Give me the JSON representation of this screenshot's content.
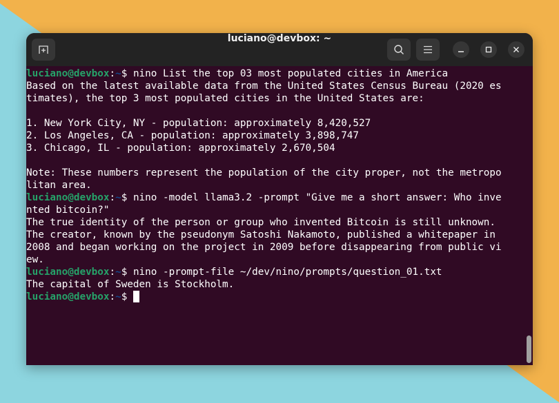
{
  "window": {
    "title": "luciano@devbox: ~"
  },
  "prompt": {
    "user": "luciano@devbox",
    "sep": ":",
    "path": "~",
    "symbol": "$ "
  },
  "lines": [
    {
      "type": "prompt",
      "cmd": "nino List the top 03 most populated cities in America"
    },
    {
      "type": "out",
      "text": "Based on the latest available data from the United States Census Bureau (2020 es"
    },
    {
      "type": "out",
      "text": "timates), the top 3 most populated cities in the United States are:"
    },
    {
      "type": "out",
      "text": ""
    },
    {
      "type": "out",
      "text": "1. New York City, NY - population: approximately 8,420,527"
    },
    {
      "type": "out",
      "text": "2. Los Angeles, CA - population: approximately 3,898,747"
    },
    {
      "type": "out",
      "text": "3. Chicago, IL - population: approximately 2,670,504"
    },
    {
      "type": "out",
      "text": ""
    },
    {
      "type": "out",
      "text": "Note: These numbers represent the population of the city proper, not the metropo"
    },
    {
      "type": "out",
      "text": "litan area."
    },
    {
      "type": "prompt",
      "cmd": "nino -model llama3.2 -prompt \"Give me a short answer: Who inve"
    },
    {
      "type": "out",
      "text": "nted bitcoin?\""
    },
    {
      "type": "out",
      "text": "The true identity of the person or group who invented Bitcoin is still unknown."
    },
    {
      "type": "out",
      "text": "The creator, known by the pseudonym Satoshi Nakamoto, published a whitepaper in"
    },
    {
      "type": "out",
      "text": "2008 and began working on the project in 2009 before disappearing from public vi"
    },
    {
      "type": "out",
      "text": "ew."
    },
    {
      "type": "prompt",
      "cmd": "nino -prompt-file ~/dev/nino/prompts/question_01.txt"
    },
    {
      "type": "out",
      "text": "The capital of Sweden is Stockholm."
    },
    {
      "type": "prompt",
      "cmd": "",
      "cursor": true
    }
  ],
  "icons": {
    "new_tab": "new-tab-icon",
    "search": "search-icon",
    "menu": "hamburger-menu-icon",
    "minimize": "minimize-icon",
    "maximize": "maximize-icon",
    "close": "close-icon"
  },
  "colors": {
    "terminal_bg": "#300a24",
    "user": "#26a269",
    "path": "#12488b",
    "titlebar": "#232323"
  }
}
